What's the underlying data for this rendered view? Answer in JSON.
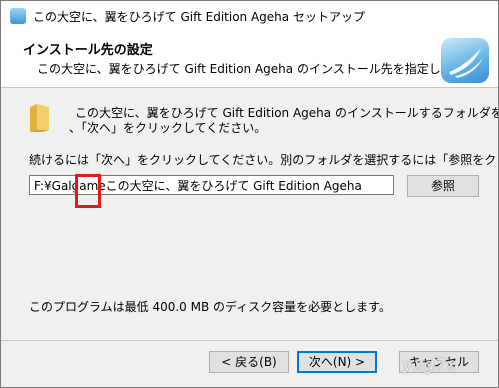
{
  "window": {
    "title": "この大空に、翼をひろげて Gift Edition Ageha セットアップ"
  },
  "header": {
    "title": "インストール先の設定",
    "subtitle": "この大空に、翼をひろげて Gift Edition Ageha のインストール先を指定してくだ"
  },
  "main": {
    "intro_line1": "この大空に、翼をひろげて Gift Edition Ageha のインストールするフォルダを指定して",
    "intro_line2": "、「次へ」をクリックしてください。",
    "instruction": "続けるには「次へ」をクリックしてください。別のフォルダを選択するには「参照をクリックしてください。",
    "path_value": "F:¥Galgameこの大空に、翼をひろげて Gift Edition Ageha",
    "browse_label": "参照",
    "disk_space": "このプログラムは最低 400.0 MB のディスク容量を必要とします。"
  },
  "footer": {
    "back_label": "< 戻る(B)",
    "next_label": "次へ(N) >",
    "cancel_label": "キャンセル"
  },
  "watermark": "yxg7x"
}
